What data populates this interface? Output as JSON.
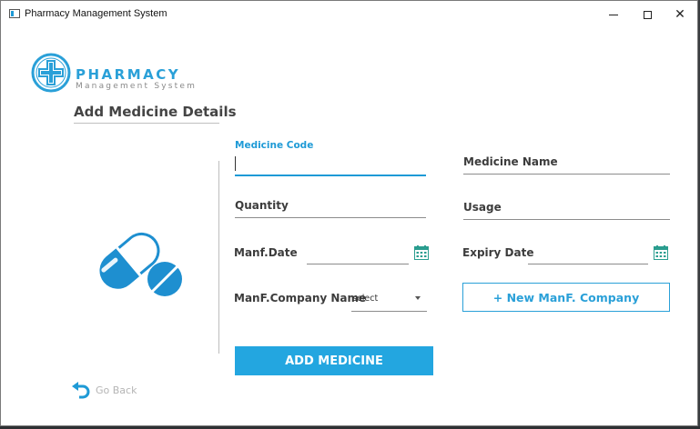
{
  "window": {
    "title": "Pharmacy Management System",
    "controls": {
      "minimize": "—",
      "maximize": "☐",
      "close": "✕"
    }
  },
  "logo": {
    "line1": "PHARMACY",
    "line2": "Management System",
    "icon": "medical-cross-icon",
    "color": "#2aa0d8"
  },
  "page": {
    "title": "Add Medicine Details"
  },
  "illustration": {
    "icon": "pills-icon",
    "color": "#1e8fd0"
  },
  "form": {
    "medicine_code": {
      "label": "Medicine Code",
      "value": ""
    },
    "medicine_name": {
      "label": "Medicine Name",
      "value": ""
    },
    "quantity": {
      "label": "Quantity",
      "value": ""
    },
    "usage": {
      "label": "Usage",
      "value": ""
    },
    "manf_date": {
      "label": "Manf.Date",
      "value": "",
      "icon": "calendar-icon"
    },
    "expiry_date": {
      "label": "Expiry Date",
      "value": "",
      "icon": "calendar-icon"
    },
    "manf_company": {
      "label": "ManF.Company Name",
      "selected": "select"
    },
    "new_company_button": "+ New ManF. Company",
    "submit_button": "ADD MEDICINE"
  },
  "footer": {
    "go_back": "Go Back",
    "icon": "undo-arrow-icon"
  },
  "colors": {
    "accent": "#1e9ad6",
    "button": "#23a6e0",
    "calendar": "#2a9d8f"
  }
}
